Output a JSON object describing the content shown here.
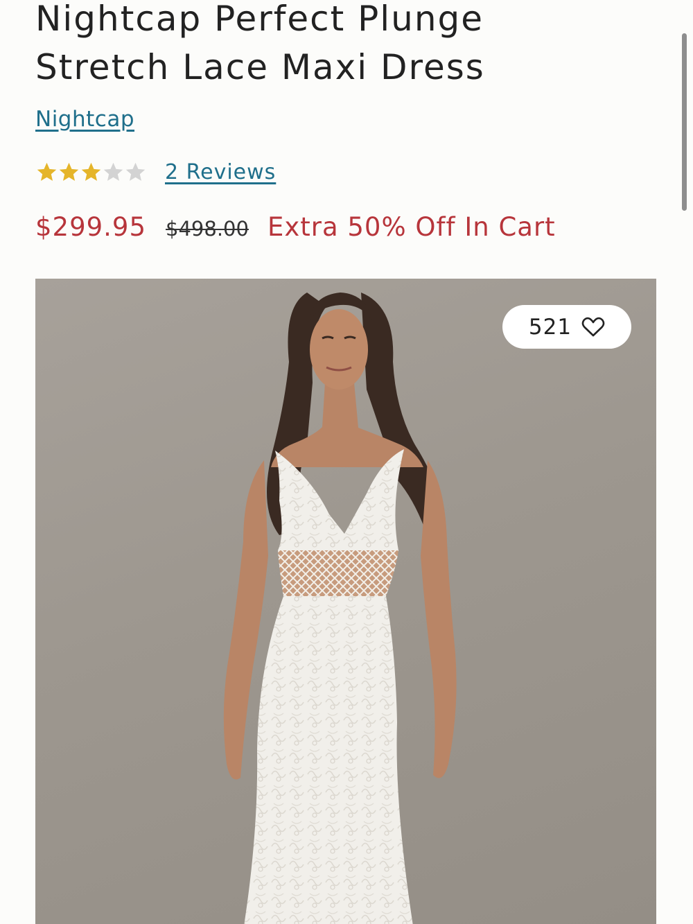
{
  "product": {
    "title_line1": "Nightcap Perfect Plunge",
    "title_line2": "Stretch Lace Maxi Dress",
    "brand": "Nightcap",
    "rating": {
      "value": 3,
      "max": 5
    },
    "reviews_label": "2 Reviews",
    "price_sale": "$299.95",
    "price_original": "$498.00",
    "promo": "Extra 50% Off In Cart"
  },
  "image": {
    "favorites_count": "521",
    "icons": {
      "favorite": "heart-outline-icon",
      "star": "star-icon"
    }
  },
  "colors": {
    "link": "#1f6f8b",
    "sale": "#b7353b",
    "star_filled": "#e5b52a",
    "star_empty": "#d3d3d3",
    "image_bg": "#9d978f"
  },
  "scroll": {
    "position": 0.0
  }
}
